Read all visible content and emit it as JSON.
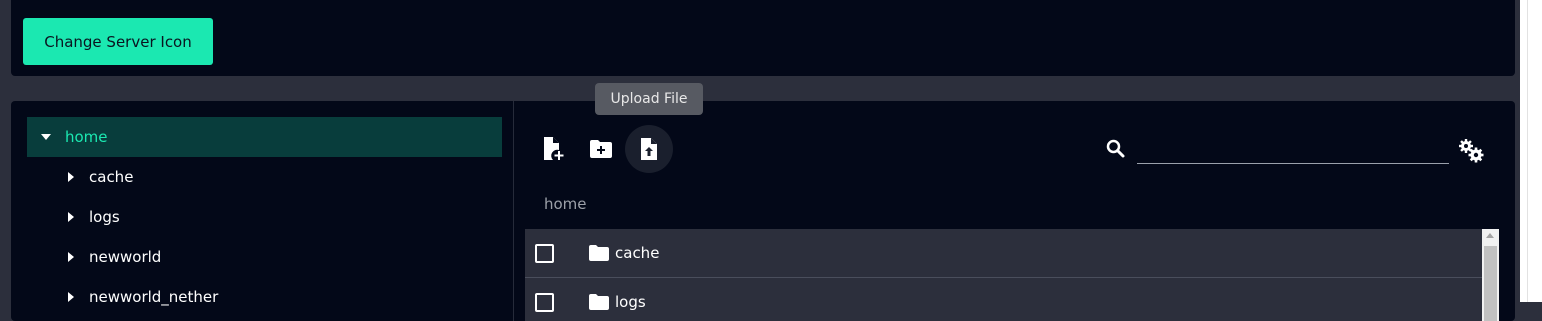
{
  "top_card": {
    "change_icon_label": "Change Server Icon"
  },
  "file_tree": {
    "root": {
      "label": "home",
      "expanded": true,
      "selected": true
    },
    "children": [
      {
        "label": "cache"
      },
      {
        "label": "logs"
      },
      {
        "label": "newworld"
      },
      {
        "label": "newworld_nether"
      }
    ]
  },
  "toolbar": {
    "new_file_icon": "file-plus-icon",
    "new_folder_icon": "folder-plus-icon",
    "upload_icon": "file-upload-icon",
    "tooltip": "Upload File",
    "search_icon": "search-icon",
    "search_value": "",
    "settings_icon": "gears-icon"
  },
  "breadcrumb": "home",
  "file_list": {
    "rows": [
      {
        "name": "cache",
        "type": "folder",
        "checked": false
      },
      {
        "name": "logs",
        "type": "folder",
        "checked": false
      }
    ]
  },
  "colors": {
    "accent": "#1be8b1",
    "background": "#2c2f3c",
    "card": "#030818",
    "selected_row": "#083d3c",
    "list_row": "#2c2f3c"
  }
}
